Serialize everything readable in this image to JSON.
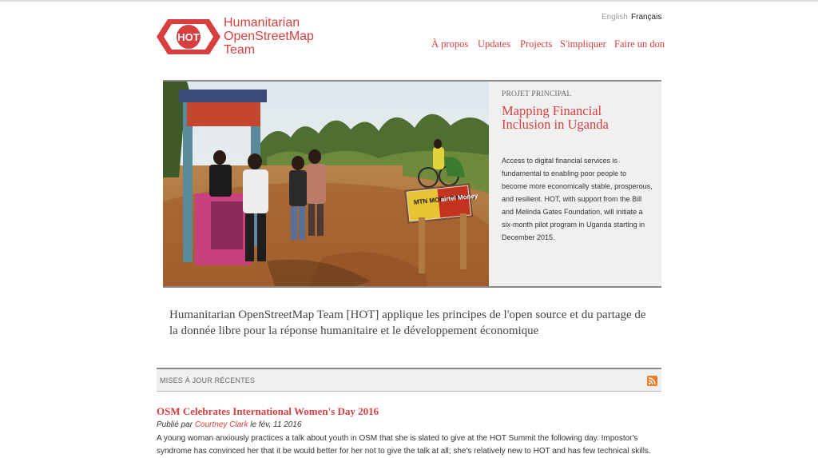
{
  "brand": {
    "logo_badge": "HOT",
    "name_line1": "Humanitarian",
    "name_line2": "OpenStreetMap",
    "name_line3": "Team",
    "accent_color": "#d73f3f"
  },
  "languages": {
    "english": "English",
    "french": "Français"
  },
  "nav": {
    "about": "À propos",
    "updates": "Updates",
    "projects": "Projects",
    "get_involved": "S'impliquer",
    "donate": "Faire un don"
  },
  "hero": {
    "kicker": "PROJET PRINCIPAL",
    "title": "Mapping Financial Inclusion in Uganda",
    "description": "Access to digital financial services is fundamental to enabling poor people to become more economically stable, prosperous, and resilient. HOT, with support from the Bill and Melinda Gates Foundation, will initiate a six-month pilot program in Uganda starting in December 2015.",
    "sign_text_1": "MTN MOBILE Money",
    "sign_text_2": "airtel Money"
  },
  "mission": "Humanitarian OpenStreetMap Team [HOT] applique les principes de l'open source et du partage de la donnée libre pour la réponse humanitaire et le développement économique",
  "updates": {
    "section_label": "MISES À JOUR RÉCENTES",
    "rss_icon": "rss-icon",
    "post": {
      "title": "OSM Celebrates International Women's Day 2016",
      "meta_prefix": "Publié par",
      "author": "Courtney Clark",
      "meta_suffix": "le fév, 11 2016",
      "excerpt": "A young woman anxiously practices a talk about youth in OSM that she is slated to give at the HOT Summit the following day. Impostor's syndrome has convinced her that it be would better for her not to give the talk at all; she's relatively new to HOT and has few technical skills."
    }
  }
}
